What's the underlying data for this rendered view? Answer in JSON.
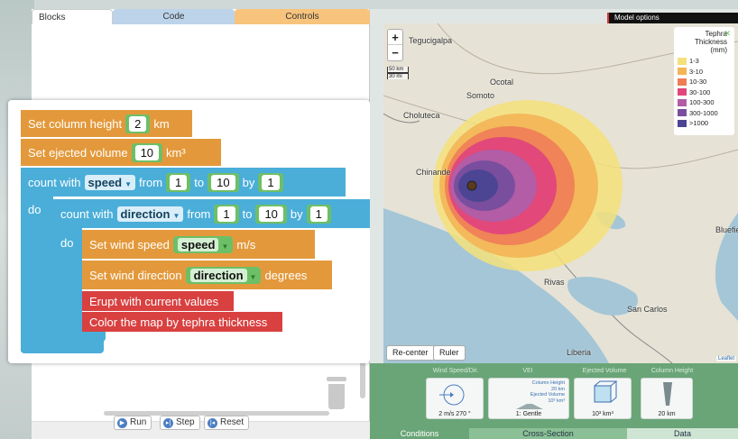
{
  "tabs": {
    "blocks": "Blocks",
    "code": "Code",
    "controls": "Controls"
  },
  "model_options": "Model options",
  "blocks": {
    "column_height": {
      "label": "Set column height",
      "value": "2",
      "unit": "km"
    },
    "ejected_volume": {
      "label": "Set ejected volume",
      "value": "10",
      "unit": "km³"
    },
    "outer_loop": {
      "count_with": "count with",
      "var": "speed",
      "from": "from",
      "from_val": "1",
      "to": "to",
      "to_val": "10",
      "by": "by",
      "by_val": "1",
      "do": "do"
    },
    "inner_loop": {
      "count_with": "count with",
      "var": "direction",
      "from": "from",
      "from_val": "1",
      "to": "to",
      "to_val": "10",
      "by": "by",
      "by_val": "1",
      "do": "do"
    },
    "wind_speed": {
      "label": "Set wind speed",
      "var": "speed",
      "unit": "m/s"
    },
    "wind_direction": {
      "label": "Set wind direction",
      "var": "direction",
      "unit": "degrees"
    },
    "erupt": "Erupt with current values",
    "color_map": "Color the map by tephra thickness"
  },
  "controls": {
    "run": "Run",
    "step": "Step",
    "reset": "Reset"
  },
  "map": {
    "zoom_in": "+",
    "zoom_out": "−",
    "scale_km": "50 km",
    "scale_mi": "30 mi",
    "places": [
      "Tegucigalpa",
      "Ocotal",
      "Somoto",
      "Choluteca",
      "Chinande",
      "Rivas",
      "San Carlos",
      "Liberia",
      "Bluefie"
    ],
    "legend_title": "Tephra Thickness (mm)",
    "legend": [
      {
        "label": "1-3",
        "color": "#f5e07a"
      },
      {
        "label": "3-10",
        "color": "#f3b557"
      },
      {
        "label": "10-30",
        "color": "#ef7d57"
      },
      {
        "label": "30-100",
        "color": "#e0457b"
      },
      {
        "label": "100-300",
        "color": "#b25da6"
      },
      {
        "label": "300-1000",
        "color": "#7a4e9e"
      },
      {
        "label": ">1000",
        "color": "#4b4594"
      }
    ],
    "recenter": "Re-center",
    "ruler": "Ruler",
    "leaflet": "Leaflet"
  },
  "conditions": {
    "wind": {
      "title": "Wind Speed/Dir.",
      "value": "2 m/s  270 °"
    },
    "vei": {
      "title": "VEI",
      "value": "1: Gentle",
      "col_height": "Column Height",
      "col_height_val": "20 km",
      "ej_vol": "Ejected Volume",
      "ej_vol_val": "10³ km³"
    },
    "ejected": {
      "title": "Ejected Volume",
      "value": "10³ km³"
    },
    "column": {
      "title": "Column Height",
      "value": "20 km"
    }
  },
  "bottom_tabs": {
    "conditions": "Conditions",
    "cross_section": "Cross-Section",
    "data": "Data"
  }
}
